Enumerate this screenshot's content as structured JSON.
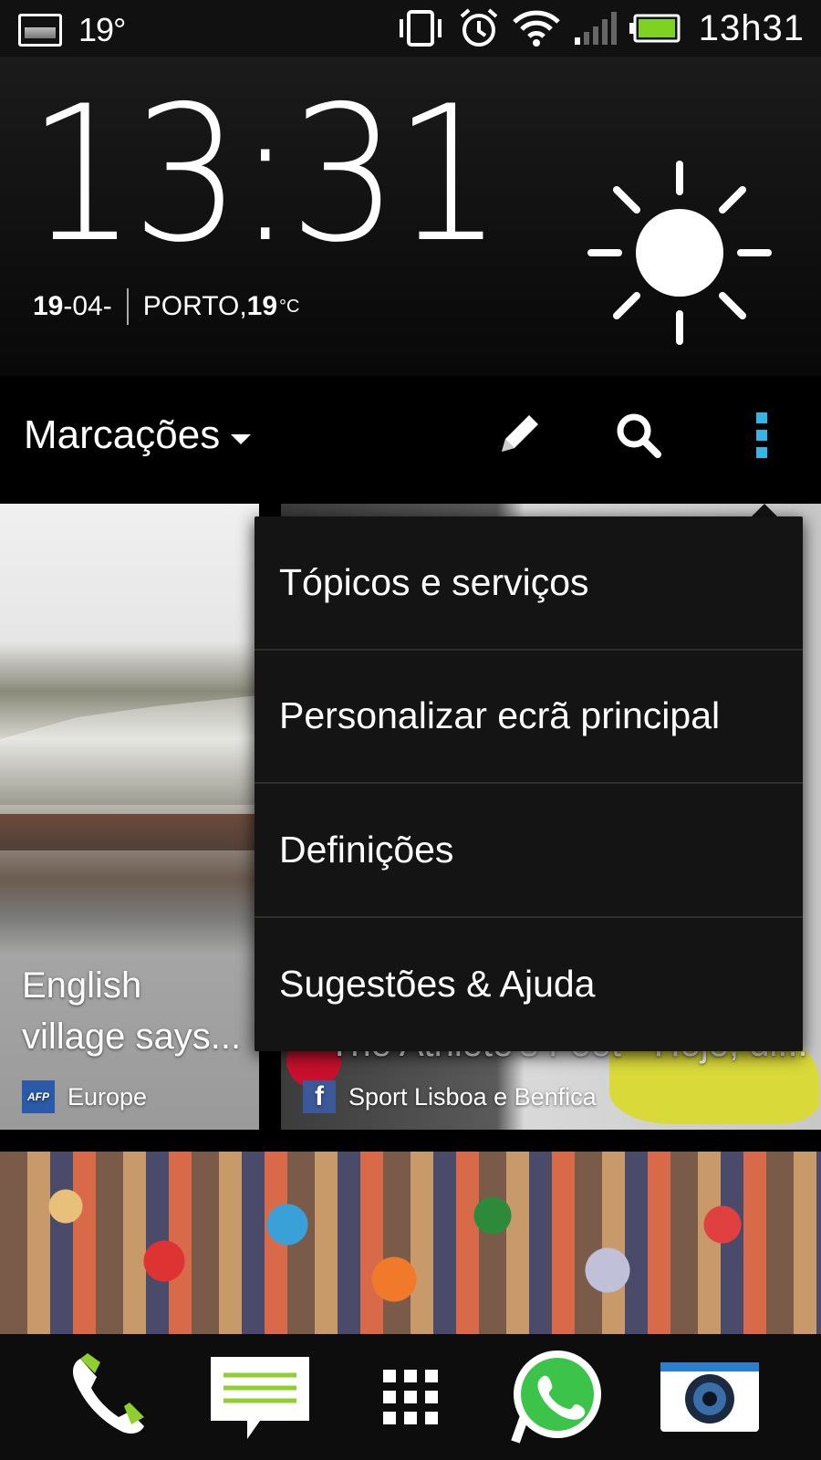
{
  "status_bar": {
    "temperature": "19°",
    "time": "13h31"
  },
  "clock_widget": {
    "time": "13:31",
    "date_day": "19",
    "date_rest": "-04-",
    "location": "PORTO, ",
    "temp_value": "19",
    "temp_unit": "°C",
    "weather_icon": "sun-icon"
  },
  "header": {
    "title": "Marcações",
    "edit_icon": "pencil-icon",
    "search_icon": "search-icon",
    "more_icon": "overflow-menu-icon"
  },
  "tiles": [
    {
      "title_line1": "English",
      "title_line2": "village says...",
      "source": "Europe",
      "source_logo": "AFP"
    },
    {
      "title_line1": "The Athlete's Foot - Hoje, di...",
      "source": "Sport Lisboa e Benfica",
      "source_logo": "f"
    }
  ],
  "menu": {
    "items": [
      {
        "label": "Tópicos e serviços"
      },
      {
        "label": "Personalizar ecrã principal"
      },
      {
        "label": "Definições"
      },
      {
        "label": "Sugestões & Ajuda"
      }
    ]
  },
  "dock": {
    "items": [
      {
        "name": "phone-icon"
      },
      {
        "name": "messages-icon"
      },
      {
        "name": "app-drawer-icon"
      },
      {
        "name": "whatsapp-icon"
      },
      {
        "name": "camera-icon"
      }
    ]
  },
  "colors": {
    "accent": "#33b5e5",
    "battery": "#7ed321",
    "menu_bg": "#141414"
  }
}
